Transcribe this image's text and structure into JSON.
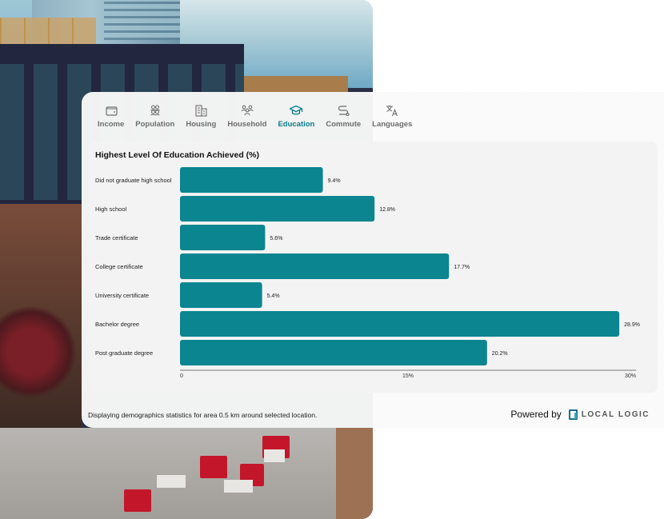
{
  "tabs": [
    {
      "label": "Income",
      "icon": "wallet-icon",
      "active": false
    },
    {
      "label": "Population",
      "icon": "people-icon",
      "active": false
    },
    {
      "label": "Housing",
      "icon": "building-icon",
      "active": false
    },
    {
      "label": "Household",
      "icon": "family-icon",
      "active": false
    },
    {
      "label": "Education",
      "icon": "graduation-cap-icon",
      "active": true
    },
    {
      "label": "Commute",
      "icon": "route-icon",
      "active": false
    },
    {
      "label": "Languages",
      "icon": "translate-icon",
      "active": false
    }
  ],
  "colors": {
    "accent": "#0a7e8a",
    "bar": "#0b8590",
    "tab_inactive": "#6d6d6d"
  },
  "chart_data": {
    "type": "bar",
    "orientation": "horizontal",
    "title": "Highest Level Of Education Achieved (%)",
    "categories": [
      "Did not graduate high school",
      "High school",
      "Trade certificate",
      "College certificate",
      "University certificate",
      "Bachelor degree",
      "Post graduate degree"
    ],
    "values": [
      9.4,
      12.8,
      5.6,
      17.7,
      5.4,
      28.9,
      20.2
    ],
    "value_labels": [
      "9.4%",
      "12.8%",
      "5.6%",
      "17.7%",
      "5.4%",
      "28.9%",
      "20.2%"
    ],
    "xlim": [
      0,
      30
    ],
    "xticks": [
      0,
      15,
      30
    ],
    "xtick_labels": [
      "0",
      "15%",
      "30%"
    ],
    "xlabel": "",
    "ylabel": "",
    "grid": false,
    "legend": "none"
  },
  "footer": {
    "note": "Displaying demographics statistics for area 0.5 km around selected location.",
    "powered_by": "Powered by",
    "brand": "LOCAL LOGIC"
  }
}
